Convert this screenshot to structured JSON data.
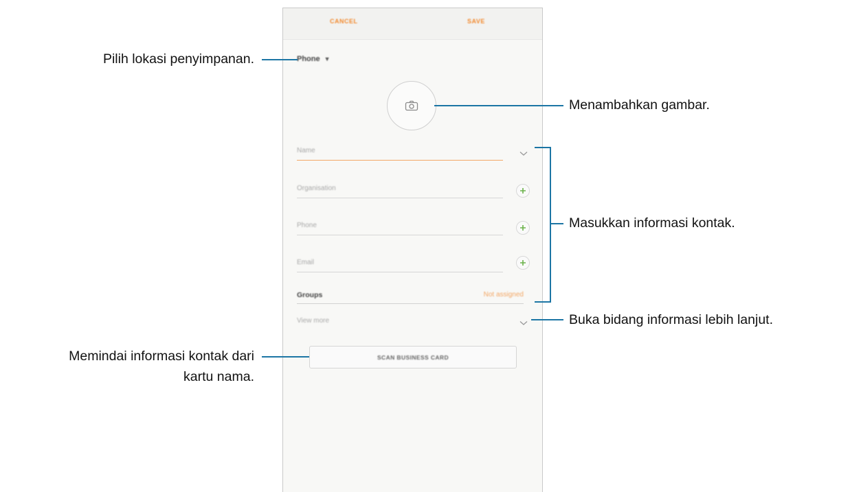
{
  "phone": {
    "topbar": {
      "cancel_label": "CANCEL",
      "save_label": "SAVE"
    },
    "storage": {
      "label": "Phone"
    },
    "fields": {
      "name_placeholder": "Name",
      "organisation_placeholder": "Organisation",
      "phone_placeholder": "Phone",
      "email_placeholder": "Email"
    },
    "groups": {
      "label": "Groups",
      "value": "Not assigned"
    },
    "view_more": "View more",
    "scan_button": "SCAN BUSINESS CARD"
  },
  "callouts": {
    "storage": "Pilih lokasi penyimpanan.",
    "image": "Menambahkan gambar.",
    "contact_info": "Masukkan informasi kontak.",
    "more_fields": "Buka bidang informasi lebih lanjut.",
    "scan_line1": "Memindai informasi kontak dari",
    "scan_line2": "kartu nama."
  },
  "colors": {
    "accent_orange": "#f28a2f",
    "plus_green": "#6bb24a",
    "callout_line": "#1b75a4"
  },
  "icons": {
    "camera": "camera-icon",
    "dropdown": "caret-down-icon",
    "expand": "chevron-down-icon",
    "add": "plus-icon"
  }
}
